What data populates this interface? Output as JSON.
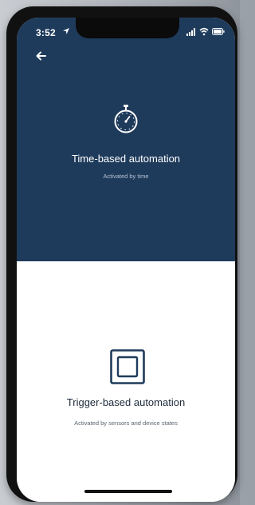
{
  "status_bar": {
    "time": "3:52",
    "icons": [
      "location-arrow-icon",
      "signal-icon",
      "wifi-icon",
      "battery-icon"
    ]
  },
  "nav": {
    "back_icon": "arrow-left-icon"
  },
  "options": [
    {
      "title": "Time-based automation",
      "subtitle": "Activated by time",
      "icon": "stopwatch-icon"
    },
    {
      "title": "Trigger-based automation",
      "subtitle": "Activated by sensors and device states",
      "icon": "square-icon"
    }
  ],
  "colors": {
    "top_panel": "#1f3b5c",
    "bottom_panel": "#ffffff",
    "accent": "#1f3b5c"
  }
}
